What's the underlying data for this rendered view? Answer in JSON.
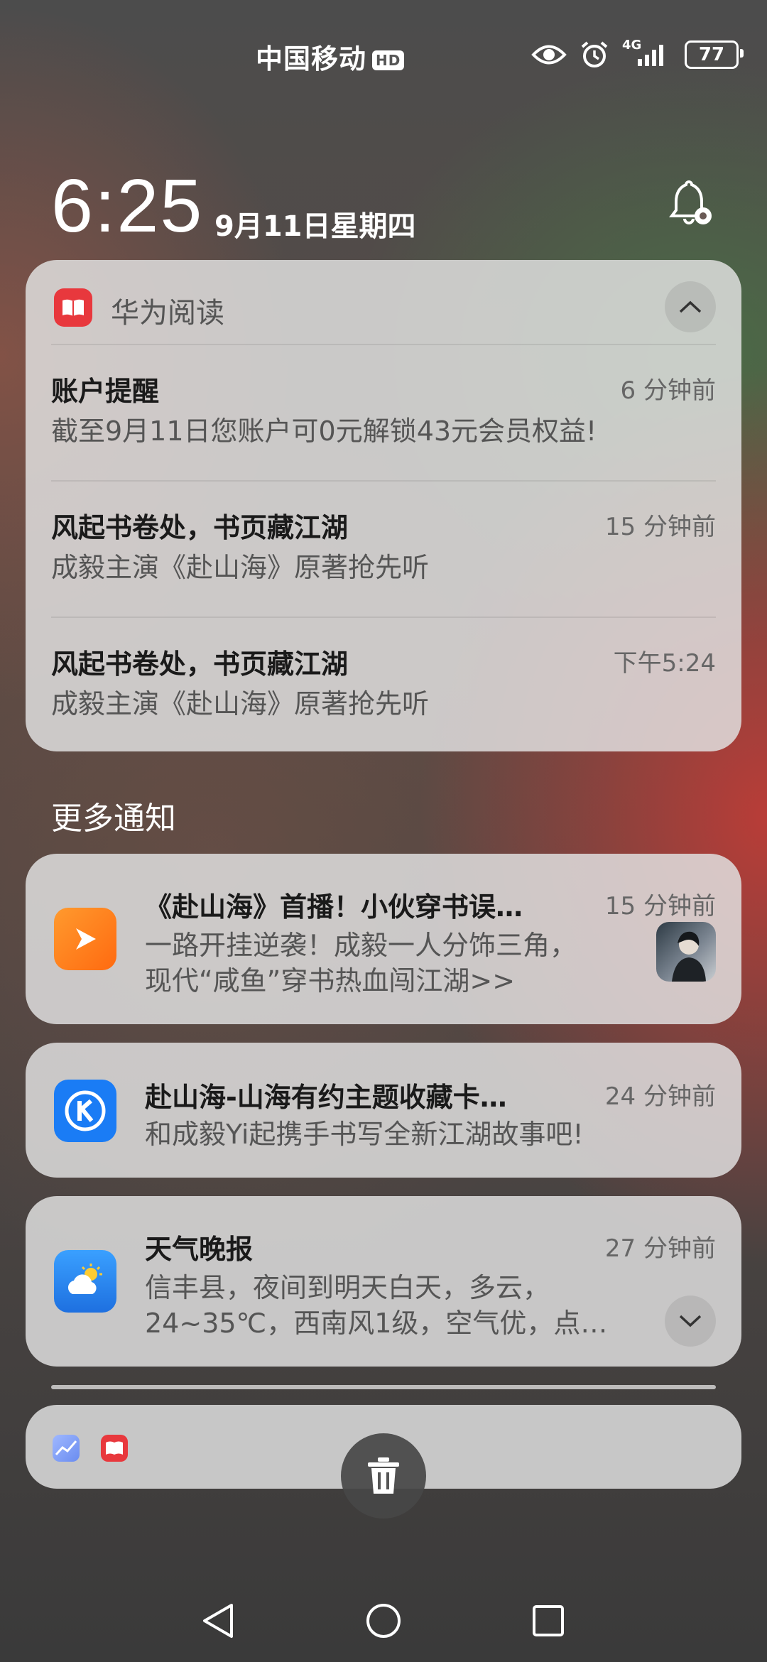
{
  "status_bar": {
    "carrier": "中国移动",
    "hd_badge": "HD",
    "network": "4G",
    "battery": "77"
  },
  "header": {
    "time": "6:25",
    "date": "9月11日星期四"
  },
  "group": {
    "app_name": "华为阅读",
    "messages": [
      {
        "title": "账户提醒",
        "time": "6 分钟前",
        "body": "截至9月11日您账户可0元解锁43元会员权益!"
      },
      {
        "title": "风起书卷处，书页藏江湖",
        "time": "15 分钟前",
        "body": "成毅主演《赴山海》原著抢先听"
      },
      {
        "title": "风起书卷处，书页藏江湖",
        "time": "下午5:24",
        "body": "成毅主演《赴山海》原著抢先听"
      }
    ]
  },
  "more_label": "更多通知",
  "notifications": [
    {
      "title": "《赴山海》首播！小伙穿书误…",
      "time": "15 分钟前",
      "body_line1": "一路开挂逆袭！成毅一人分饰三角，",
      "body_line2": "现代“咸鱼”穿书热血闯江湖>>"
    },
    {
      "title": "赴山海-山海有约主题收藏卡…",
      "time": "24 分钟前",
      "body_line1": "和成毅Yi起携手书写全新江湖故事吧!"
    },
    {
      "title": "天气晚报",
      "time": "27 分钟前",
      "body_line1": "信丰县，夜间到明天白天，多云，",
      "body_line2": "24~35℃，西南风1级，空气优，点…"
    }
  ],
  "colors": {
    "reader_red": "#e8383d",
    "video_orange": "#ff7a1a",
    "kugou_blue": "#1a7cf5",
    "weather_blue": "#2a8cf0"
  }
}
